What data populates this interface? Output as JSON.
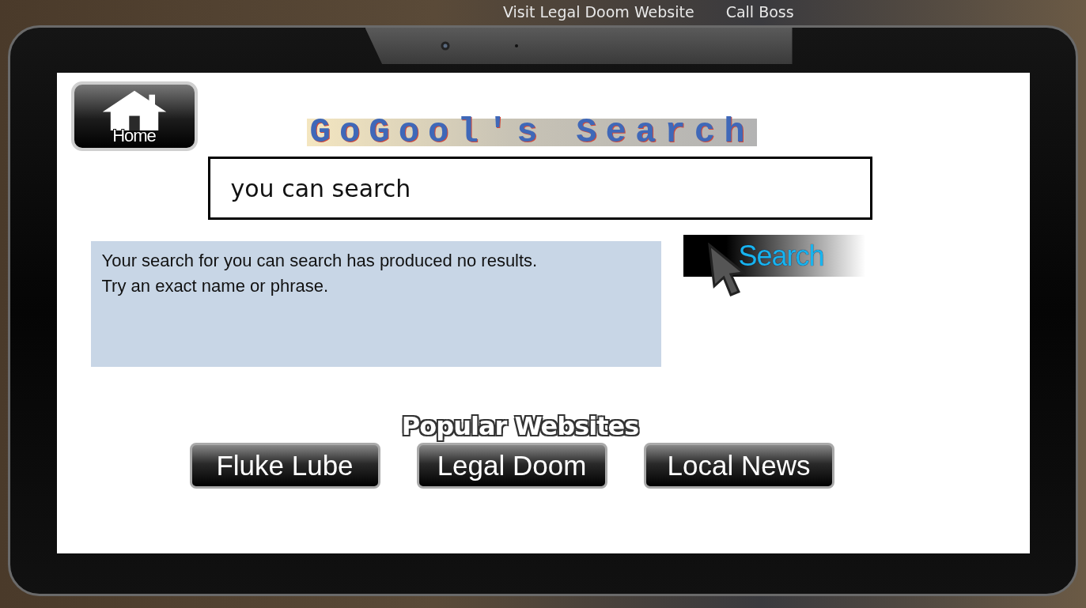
{
  "scene_actions": [
    "Visit Legal Doom Website",
    "Call Boss"
  ],
  "home_button": {
    "label": "Home"
  },
  "logo": "GoGool's Search",
  "search_field": {
    "value": "you can search"
  },
  "results": {
    "lines": [
      "Your search for you can search has produced no results.",
      "Try an exact name or phrase."
    ]
  },
  "search_button": {
    "label": "Search"
  },
  "popular": {
    "title": "Popular Websites",
    "sites": [
      "Fluke Lube",
      "Legal Doom",
      "Local News"
    ]
  }
}
